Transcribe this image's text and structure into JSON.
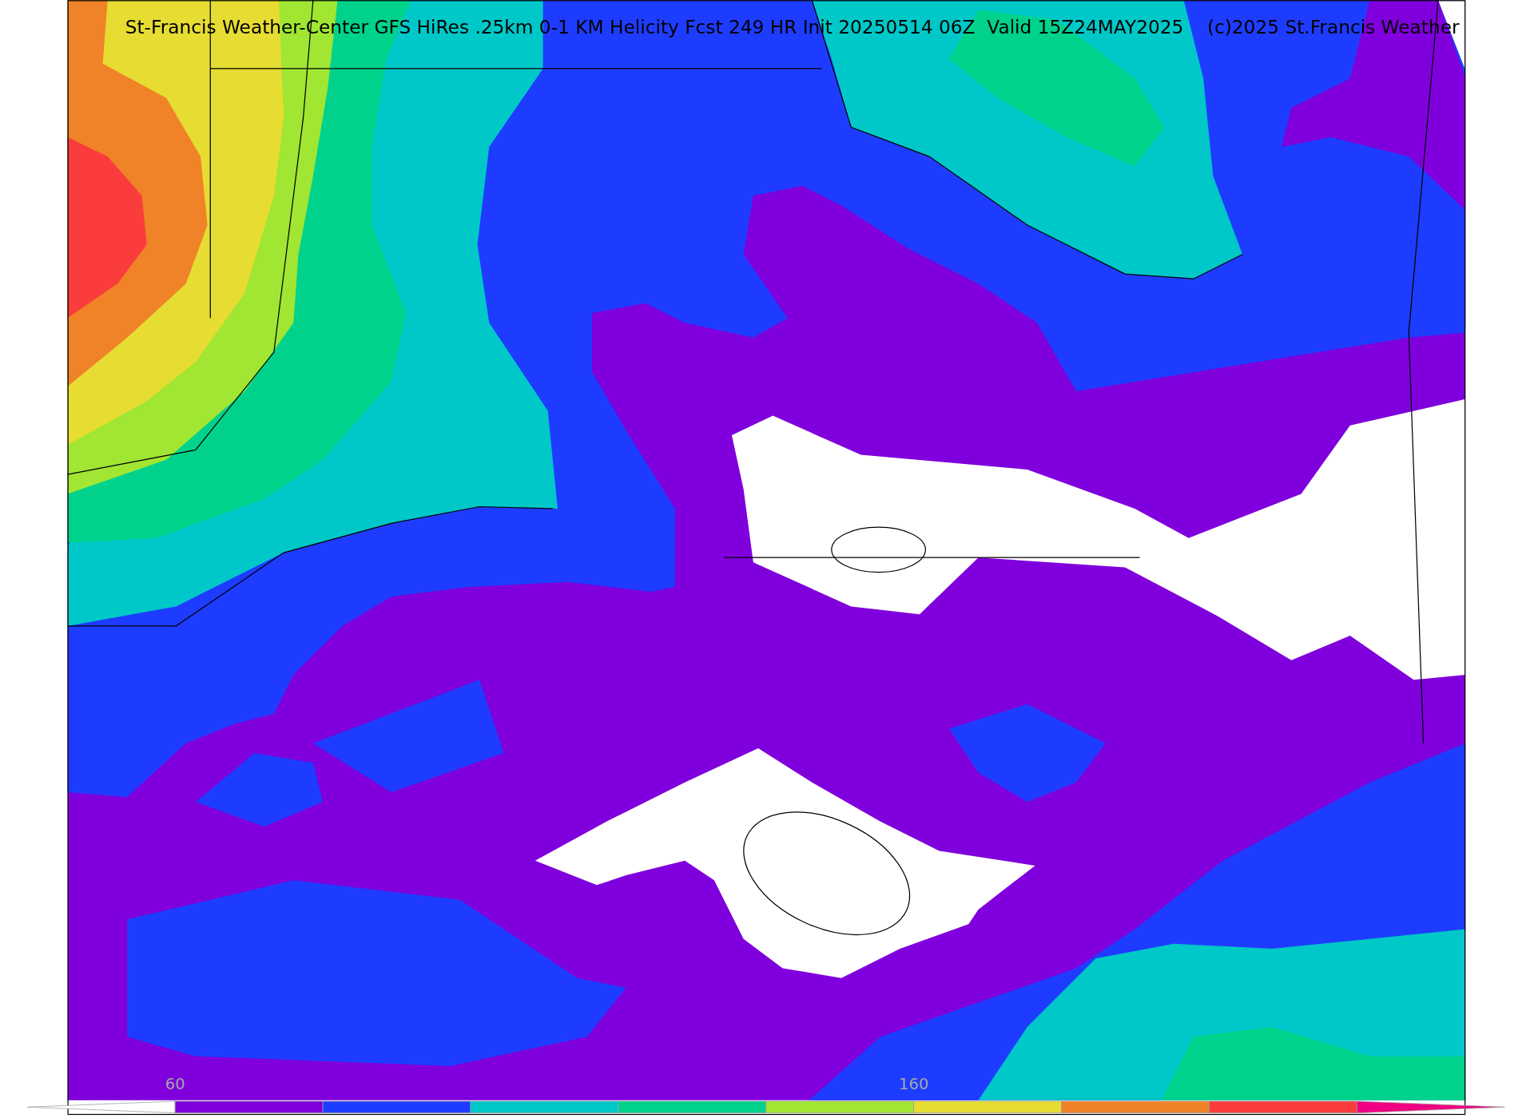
{
  "title": "St-Francis Weather-Center GFS HiRes .25km 0-1 KM Helicity Fcst 249 HR Init 20250514 06Z  Valid 15Z24MAY2025    (c)2025 St.Francis Weather",
  "colorbar": {
    "bins": [
      {
        "color": "#ffffff"
      },
      {
        "color": "#7f00dc",
        "label": "60"
      },
      {
        "color": "#1e3cff"
      },
      {
        "color": "#00c8c8"
      },
      {
        "color": "#00d28c"
      },
      {
        "color": "#a0e632"
      },
      {
        "color": "#e6dc32",
        "label": "160"
      },
      {
        "color": "#f08228"
      },
      {
        "color": "#fa3c3c"
      },
      {
        "color": "#f00082"
      }
    ]
  }
}
